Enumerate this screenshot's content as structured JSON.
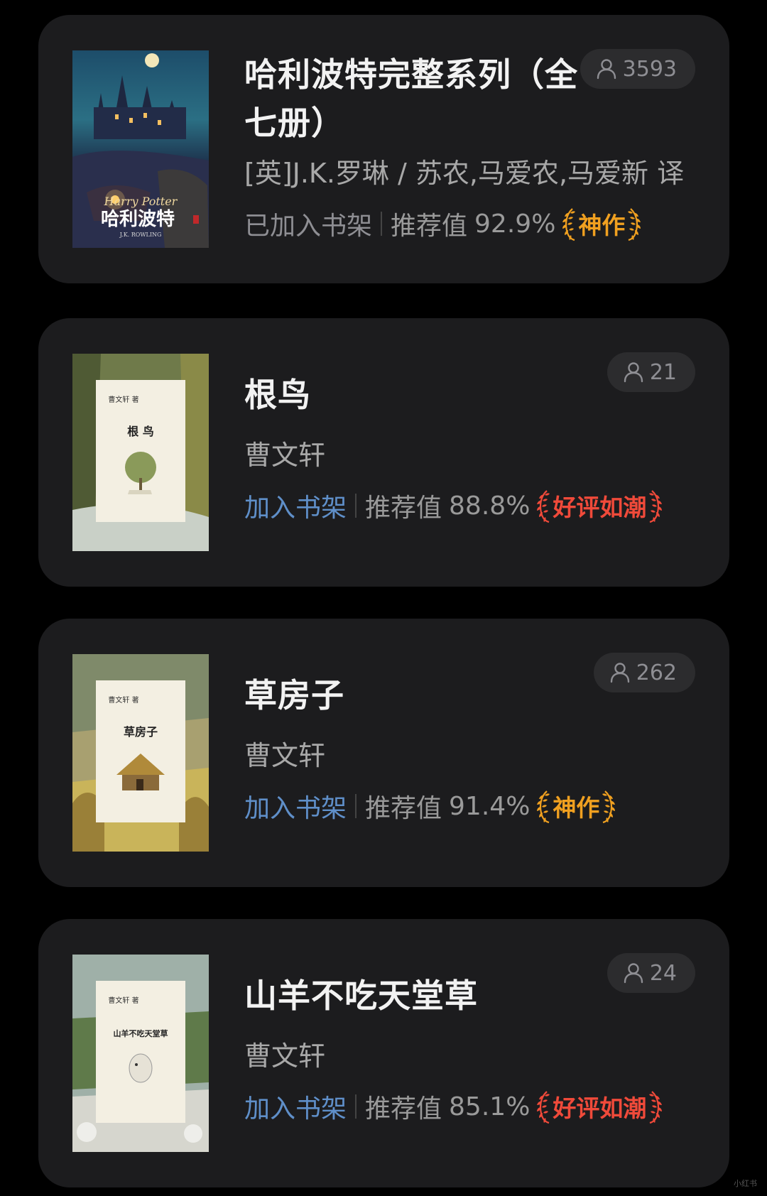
{
  "colors": {
    "background": "#000000",
    "card": "#1c1c1e",
    "title": "#f2f2f2",
    "add_to_shelf": "#5f8fc9",
    "badge_masterpiece": "#f0a020",
    "badge_acclaimed": "#f04a3a"
  },
  "books": [
    {
      "title": "哈利波特完整系列（全七册）",
      "author": "[英]J.K.罗琳 / 苏农,马爱农,马爱新 译",
      "shelf_label": "已加入书架",
      "rec_label": "推荐值",
      "rec_value": "92.9%",
      "badge": "神作",
      "readers": "3593",
      "icon": "user-icon"
    },
    {
      "title": "根鸟",
      "author": "曹文轩",
      "shelf_label": "加入书架",
      "rec_label": "推荐值",
      "rec_value": "88.8%",
      "badge": "好评如潮",
      "readers": "21",
      "icon": "user-icon"
    },
    {
      "title": "草房子",
      "author": "曹文轩",
      "shelf_label": "加入书架",
      "rec_label": "推荐值",
      "rec_value": "91.4%",
      "badge": "神作",
      "readers": "262",
      "icon": "user-icon"
    },
    {
      "title": "山羊不吃天堂草",
      "author": "曹文轩",
      "shelf_label": "加入书架",
      "rec_label": "推荐值",
      "rec_value": "85.1%",
      "badge": "好评如潮",
      "readers": "24",
      "icon": "user-icon"
    }
  ],
  "covers": {
    "hp_series": "Harry Potter",
    "hp_title": "哈利波特",
    "hp_author": "J.K. ROWLING",
    "cao_author": "曹文轩 著",
    "gen_niao": "根 鸟",
    "cao_fang_zi": "草房子",
    "shan_yang": "山羊不吃天堂草"
  },
  "watermark": "小红书"
}
